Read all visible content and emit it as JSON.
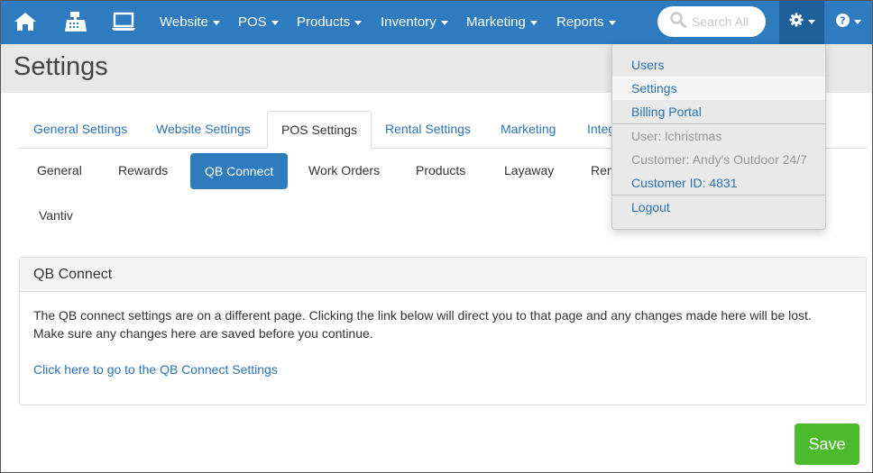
{
  "navbar": {
    "menus": [
      {
        "label": "Website"
      },
      {
        "label": "POS"
      },
      {
        "label": "Products"
      },
      {
        "label": "Inventory"
      },
      {
        "label": "Marketing"
      },
      {
        "label": "Reports"
      }
    ],
    "search_placeholder": "Search All",
    "accent_color": "#2e7bbf",
    "icons": [
      "home-icon",
      "cash-register-icon",
      "laptop-icon",
      "search-icon",
      "gear-icon",
      "help-icon"
    ]
  },
  "page": {
    "title": "Settings"
  },
  "tabs": [
    {
      "label": "General Settings"
    },
    {
      "label": "Website Settings"
    },
    {
      "label": "POS Settings",
      "active": true
    },
    {
      "label": "Rental Settings"
    },
    {
      "label": "Marketing"
    },
    {
      "label": "Integ"
    }
  ],
  "subtabs": [
    {
      "label": "General"
    },
    {
      "label": "Rewards"
    },
    {
      "label": "QB Connect",
      "active": true
    },
    {
      "label": "Work Orders"
    },
    {
      "label": "Products"
    },
    {
      "label": "Layaway"
    },
    {
      "label": "Ren"
    },
    {
      "label": "Vantiv"
    }
  ],
  "panel": {
    "heading": "QB Connect",
    "line1": "The QB connect settings are on a different page. Clicking the link below will direct you to that page and any changes made here will be lost.",
    "line2": "Make sure any changes here are saved before you continue.",
    "link": "Click here to go to the QB Connect Settings"
  },
  "save_label": "Save",
  "dropdown": {
    "users": "Users",
    "settings": "Settings",
    "billing": "Billing Portal",
    "user": "User: lchristmas",
    "customer": "Customer: Andy's Outdoor 24/7",
    "customer_id": "Customer ID: 4831",
    "logout": "Logout"
  }
}
